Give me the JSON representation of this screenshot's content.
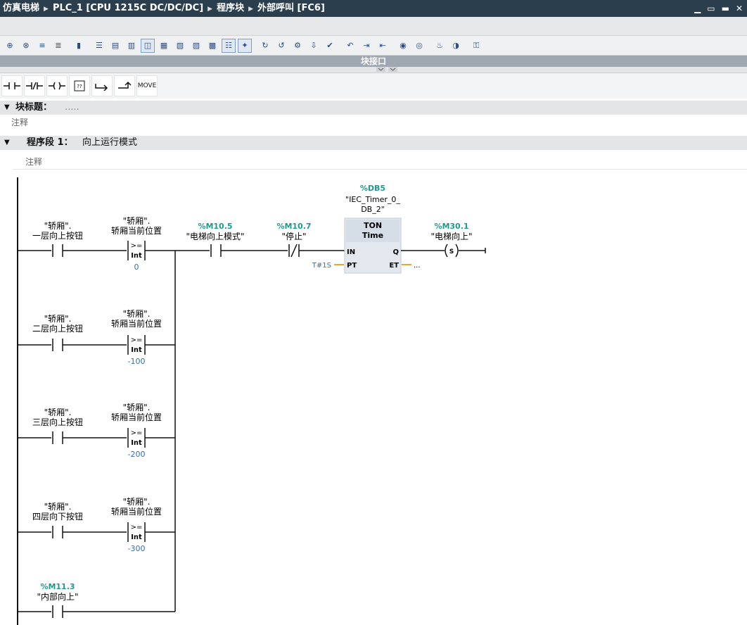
{
  "window": {
    "project": "仿真电梯",
    "device": "PLC_1 [CPU 1215C DC/DC/DC]",
    "folder": "程序块",
    "block": "外部呼叫 [FC6]"
  },
  "panels": {
    "block_interface": "块接口"
  },
  "ladder_toolbar": {
    "move_label": "MOVE"
  },
  "block_title": {
    "label": "块标题：",
    "value": ".....",
    "comment": "注释"
  },
  "network": {
    "label": "程序段 1：",
    "title": "向上运行模式",
    "comment": "注释",
    "branches": [
      {
        "contact_name": [
          "\"轿厢\".",
          "一层向上按钮"
        ],
        "cmp_name": [
          "\"轿厢\".",
          "轿厢当前位置"
        ],
        "cmp_op": ">=",
        "cmp_type": "Int",
        "cmp_value": "0"
      },
      {
        "contact_name": [
          "\"轿厢\".",
          "二层向上按钮"
        ],
        "cmp_name": [
          "\"轿厢\".",
          "轿厢当前位置"
        ],
        "cmp_op": ">=",
        "cmp_type": "Int",
        "cmp_value": "-100"
      },
      {
        "contact_name": [
          "\"轿厢\".",
          "三层向上按钮"
        ],
        "cmp_name": [
          "\"轿厢\".",
          "轿厢当前位置"
        ],
        "cmp_op": ">=",
        "cmp_type": "Int",
        "cmp_value": "-200"
      },
      {
        "contact_name": [
          "\"轿厢\".",
          "四层向下按钮"
        ],
        "cmp_name": [
          "\"轿厢\".",
          "轿厢当前位置"
        ],
        "cmp_op": ">=",
        "cmp_type": "Int",
        "cmp_value": "-300"
      }
    ],
    "inner_contact": {
      "address": "%M11.3",
      "name": "\"内部向上\""
    },
    "mode_contact": {
      "address": "%M10.5",
      "name": "\"电梯向上模式\""
    },
    "stop_contact": {
      "address": "%M10.7",
      "name": "\"停止\""
    },
    "timer": {
      "db": "%DB5",
      "instance_line1": "\"IEC_Timer_0_",
      "instance_line2": "DB_2\"",
      "type": "TON",
      "subtype": "Time",
      "pin_in": "IN",
      "pin_pt": "PT",
      "pin_q": "Q",
      "pin_et": "ET",
      "pt_value": "T#1S",
      "et_value": "..."
    },
    "coil": {
      "address": "%M30.1",
      "name": "\"电梯向上\"",
      "type": "S"
    }
  },
  "colors": {
    "title_bg": "#2b3e4e",
    "address": "#1e9a8f",
    "value": "#3a6ea5",
    "pin_line": "#e8a33a"
  }
}
